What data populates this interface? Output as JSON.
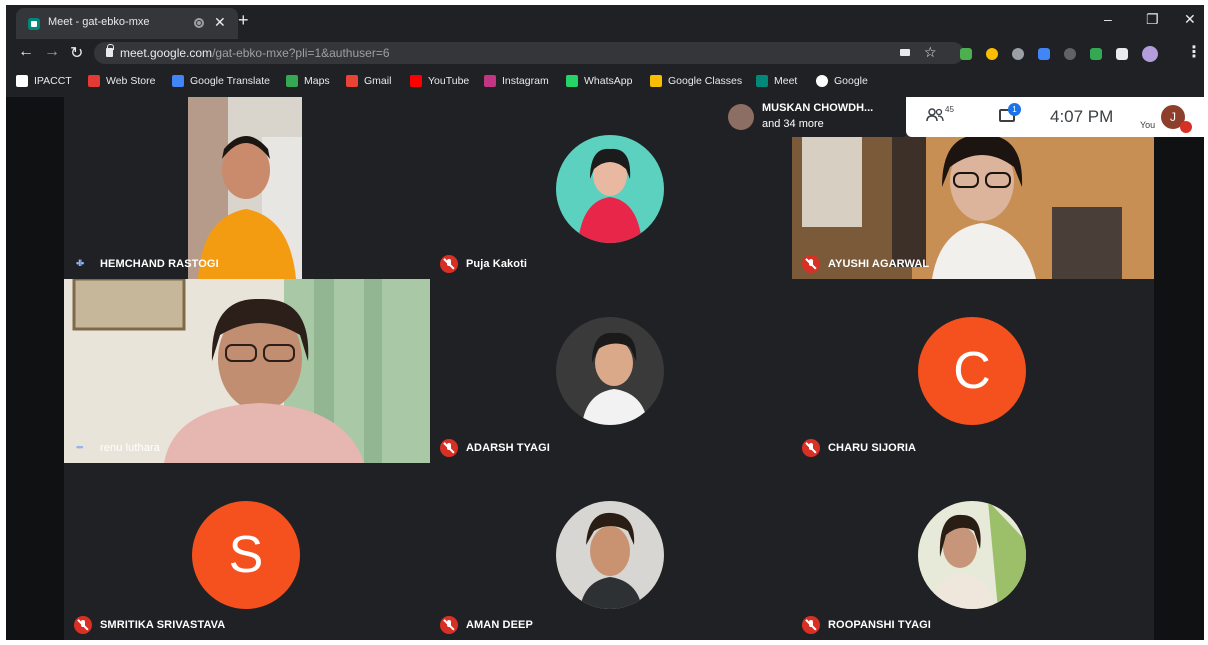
{
  "browser": {
    "tab_title": "Meet - gat-ebko-mxe",
    "url_domain": "meet.google.com",
    "url_path": "/gat-ebko-mxe?pli=1&authuser=6",
    "new_tab": "+",
    "tab_close": "✕",
    "win_min": "–",
    "win_restore": "❐",
    "win_close": "✕",
    "back": "←",
    "forward": "→",
    "reload": "↻",
    "star": "☆",
    "menu": "⋮"
  },
  "bookmarks": [
    {
      "label": "IPACCT",
      "color": "#ffffff"
    },
    {
      "label": "Web Store",
      "color": "#e53935"
    },
    {
      "label": "Google Translate",
      "color": "#4285f4"
    },
    {
      "label": "Maps",
      "color": "#34a853"
    },
    {
      "label": "Gmail",
      "color": "#ea4335"
    },
    {
      "label": "YouTube",
      "color": "#ff0000"
    },
    {
      "label": "Instagram",
      "color": "#c13584"
    },
    {
      "label": "WhatsApp",
      "color": "#25d366"
    },
    {
      "label": "Google Classes",
      "color": "#fbbc04"
    },
    {
      "label": "Meet",
      "color": "#00897b"
    },
    {
      "label": "Google",
      "color": "#ffffff"
    }
  ],
  "meet": {
    "presenter_name": "MUSKAN CHOWDH...",
    "presenter_more": "and 34 more",
    "people_count": "45",
    "chat_badge": "1",
    "time": "4:07 PM",
    "you_label": "You",
    "you_initial": "J"
  },
  "participants": [
    {
      "name": "HEMCHAND RASTOGI",
      "status": "speaking"
    },
    {
      "name": "Puja Kakoti",
      "status": "muted"
    },
    {
      "name": "AYUSHI AGARWAL",
      "status": "muted"
    },
    {
      "name": "renu luthara",
      "status": "speaking"
    },
    {
      "name": "ADARSH TYAGI",
      "status": "muted"
    },
    {
      "name": "CHARU SIJORIA",
      "status": "muted",
      "initial": "C"
    },
    {
      "name": "SMRITIKA SRIVASTAVA",
      "status": "muted",
      "initial": "S"
    },
    {
      "name": "AMAN DEEP",
      "status": "muted"
    },
    {
      "name": "ROOPANSHI TYAGI",
      "status": "muted"
    }
  ]
}
